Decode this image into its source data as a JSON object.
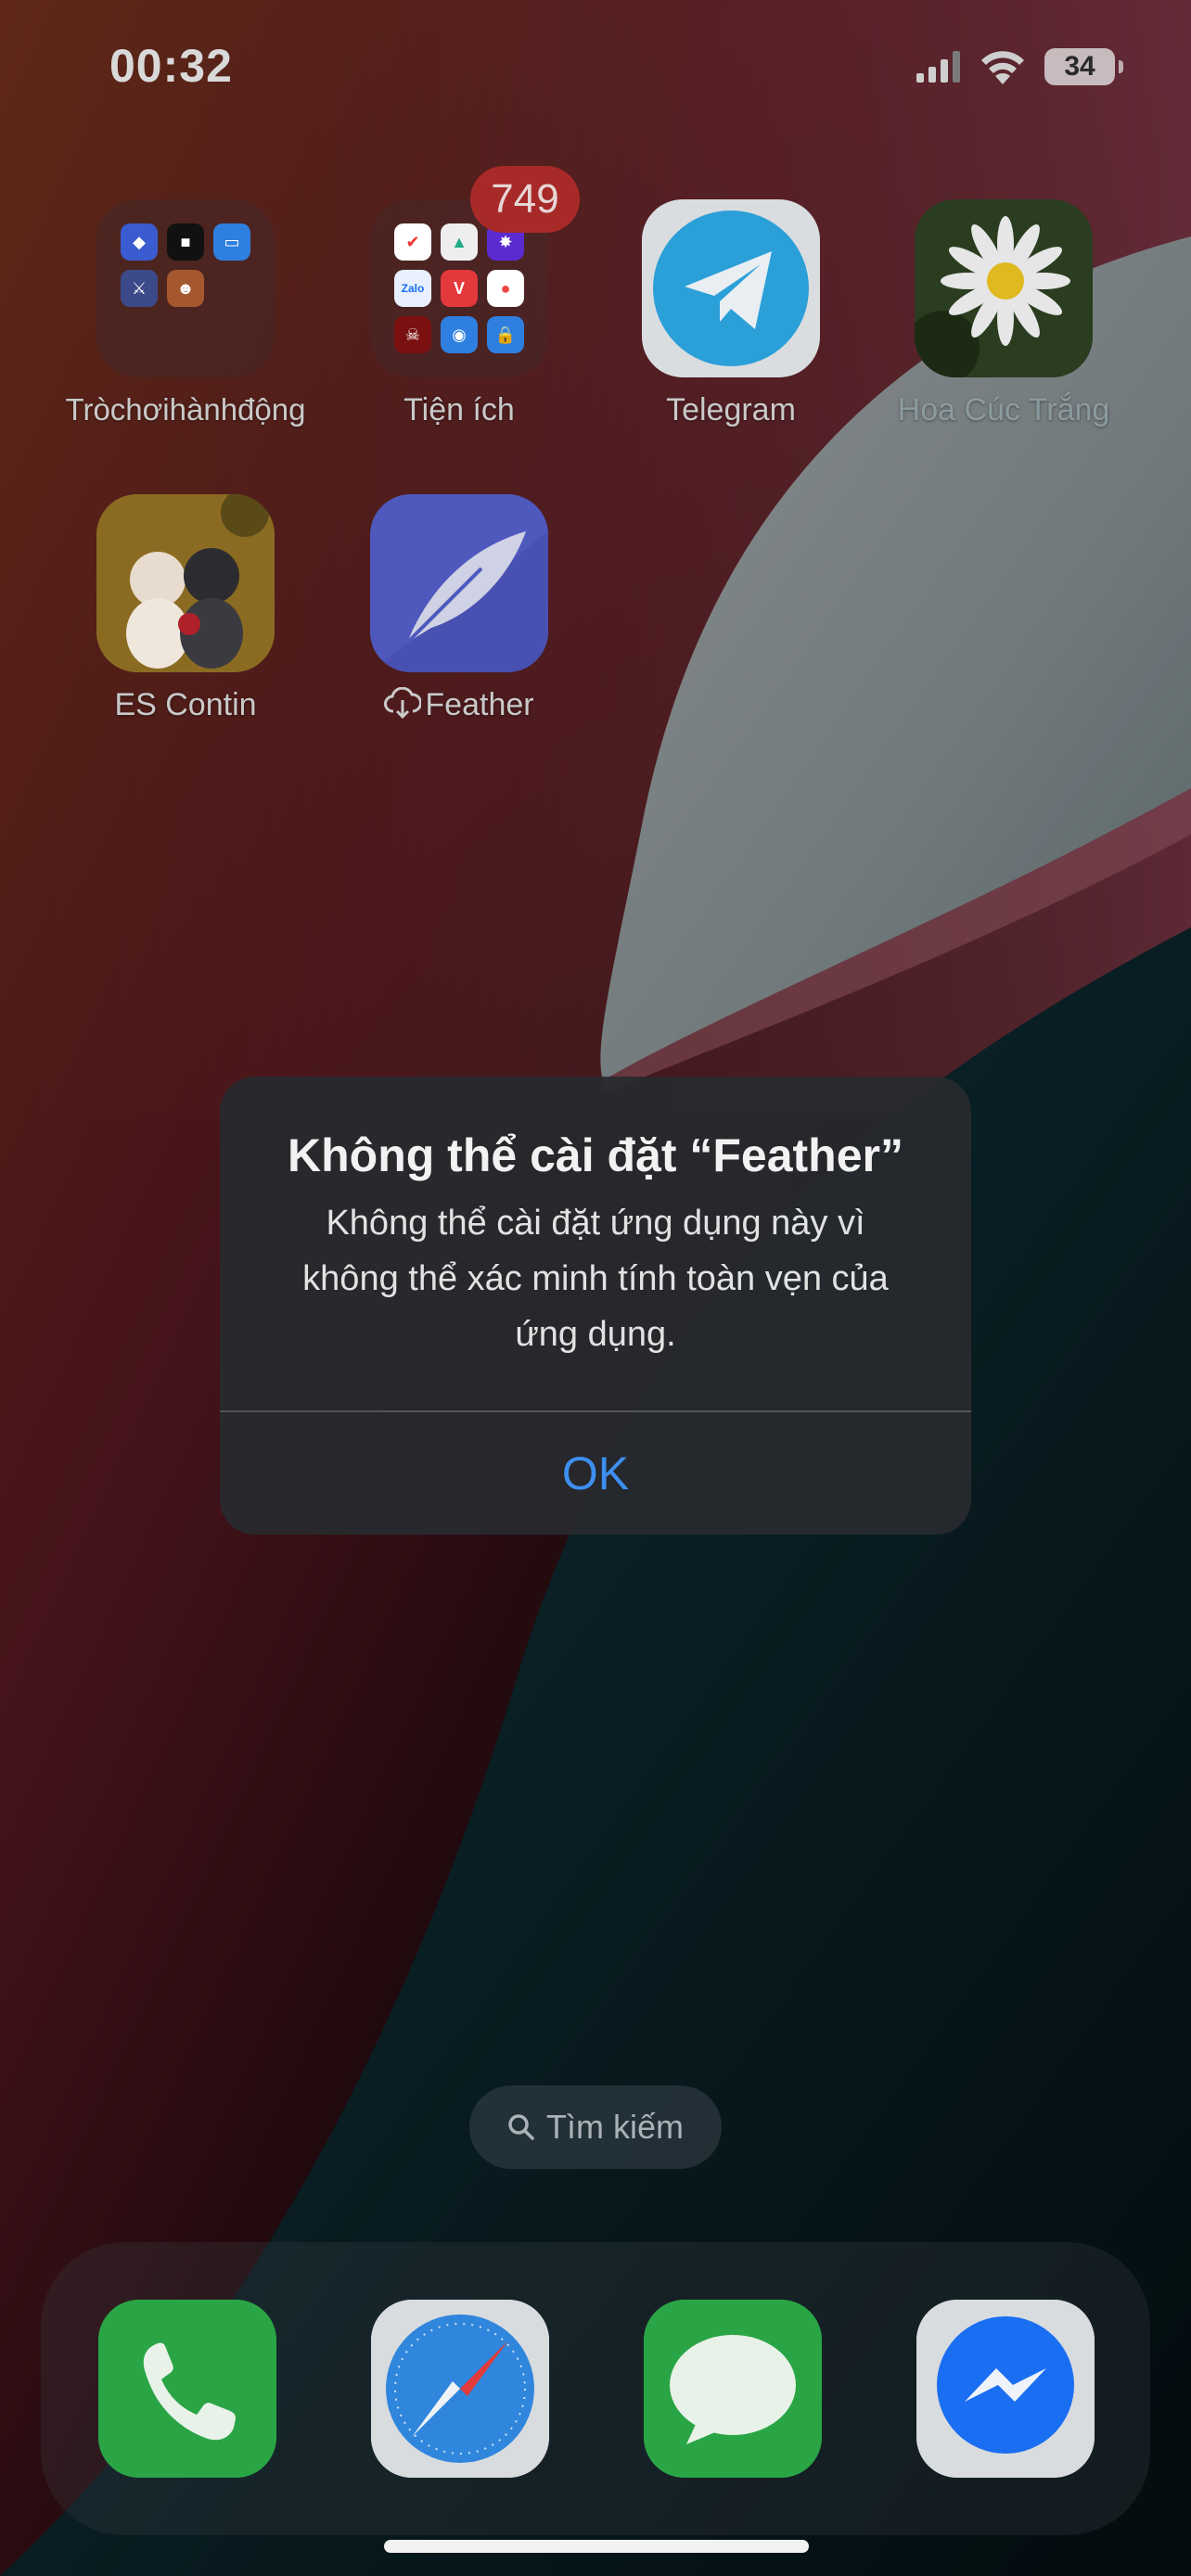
{
  "status_bar": {
    "time": "00:32",
    "battery_level": "34",
    "signal_icon": "cellular-signal-icon",
    "wifi_icon": "wifi-icon"
  },
  "apps": {
    "folder_games": {
      "label": "Tròchơihànhđộng",
      "icon": "folder-icon"
    },
    "folder_utilities": {
      "label": "Tiện ích",
      "badge": "749",
      "icon": "folder-icon",
      "mini_labels": [
        "Zalo",
        "V"
      ]
    },
    "telegram": {
      "label": "Telegram",
      "icon": "telegram-icon"
    },
    "daisy": {
      "label": "Hoa Cúc Trắng",
      "icon": "daisy-flower-icon"
    },
    "es_contin": {
      "label": "ES Contin",
      "icon": "kittens-icon"
    },
    "feather": {
      "label": "Feather",
      "icon": "feather-icon",
      "status_icon": "cloud-download-icon"
    }
  },
  "alert": {
    "title": "Không thể cài đặt “Feather”",
    "message": "Không thể cài đặt ứng dụng này vì không thể xác minh tính toàn vẹn của ứng dụng.",
    "ok_label": "OK"
  },
  "search": {
    "label": "Tìm kiếm",
    "icon": "search-icon"
  },
  "dock": {
    "apps": [
      {
        "name": "phone",
        "icon": "phone-icon"
      },
      {
        "name": "safari",
        "icon": "safari-compass-icon"
      },
      {
        "name": "messages",
        "icon": "messages-icon"
      },
      {
        "name": "messenger",
        "icon": "messenger-icon"
      }
    ]
  },
  "colors": {
    "alert_button": "#3d8ff0",
    "badge": "#a82a28",
    "telegram": "#2b9fd8",
    "feather": "#5a63c8",
    "phone": "#2fb24a",
    "messages": "#2fb24a",
    "messenger": "#1a6ef2"
  }
}
